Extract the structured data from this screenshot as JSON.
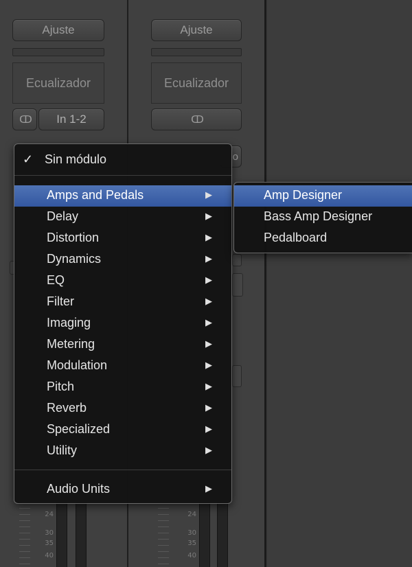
{
  "strip1": {
    "setting_label": "Ajuste",
    "eq_label": "Ecualizador",
    "link_symbol": "ↀ",
    "input_label": "In 1-2"
  },
  "strip2": {
    "setting_label": "Ajuste",
    "eq_label": "Ecualizador",
    "link_symbol": "ↀ",
    "partial_label": "o"
  },
  "meter_ticks": [
    "24",
    "30",
    "35",
    "40"
  ],
  "plugin_menu": {
    "checked_item": {
      "check": "✓",
      "label": "Sin módulo"
    },
    "items": [
      {
        "label": "Amps and Pedals",
        "arrow": "▶"
      },
      {
        "label": "Delay",
        "arrow": "▶"
      },
      {
        "label": "Distortion",
        "arrow": "▶"
      },
      {
        "label": "Dynamics",
        "arrow": "▶"
      },
      {
        "label": "EQ",
        "arrow": "▶"
      },
      {
        "label": "Filter",
        "arrow": "▶"
      },
      {
        "label": "Imaging",
        "arrow": "▶"
      },
      {
        "label": "Metering",
        "arrow": "▶"
      },
      {
        "label": "Modulation",
        "arrow": "▶"
      },
      {
        "label": "Pitch",
        "arrow": "▶"
      },
      {
        "label": "Reverb",
        "arrow": "▶"
      },
      {
        "label": "Specialized",
        "arrow": "▶"
      },
      {
        "label": "Utility",
        "arrow": "▶"
      }
    ],
    "audio_units": {
      "label": "Audio Units",
      "arrow": "▶"
    },
    "highlight_color": "#3f63ab"
  },
  "submenu": {
    "items": [
      {
        "label": "Amp Designer"
      },
      {
        "label": "Bass Amp Designer"
      },
      {
        "label": "Pedalboard"
      }
    ]
  }
}
